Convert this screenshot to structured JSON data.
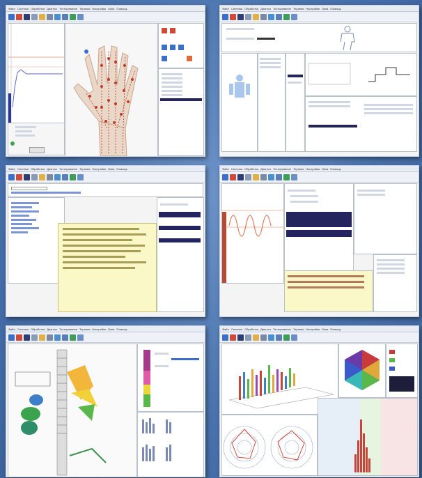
{
  "screenshots": [
    {
      "name": "hand-acupuncture-view",
      "menu": [
        "Файл",
        "Система",
        "Обработка",
        "Диагноз",
        "Тестирование",
        "Терапия",
        "Настройки",
        "Окна",
        "Помощь"
      ]
    },
    {
      "name": "patient-body-diagram-view",
      "menu": [
        "Файл",
        "Система",
        "Обработка",
        "Диагноз",
        "Тестирование",
        "Терапия",
        "Настройки",
        "Окна",
        "Помощь"
      ]
    },
    {
      "name": "diagnosis-list-view",
      "menu": [
        "Файл",
        "Система",
        "Обработка",
        "Диагноз",
        "Тестирование",
        "Терапия",
        "Настройки",
        "Окна",
        "Помощь"
      ]
    },
    {
      "name": "waveform-analysis-view",
      "menu": [
        "Файл",
        "Система",
        "Обработка",
        "Диагноз",
        "Тестирование",
        "Терапия",
        "Настройки",
        "Окна",
        "Помощь"
      ]
    },
    {
      "name": "spine-organs-view",
      "menu": [
        "Файл",
        "Система",
        "Обработка",
        "Диагноз",
        "Тестирование",
        "Терапия",
        "Настройки",
        "Окна",
        "Помощь"
      ]
    },
    {
      "name": "spectrum-charts-view",
      "menu": [
        "Файл",
        "Система",
        "Обработка",
        "Диагноз",
        "Тестирование",
        "Терапия",
        "Настройки",
        "Окна",
        "Помощь"
      ]
    }
  ],
  "colors": {
    "background": "#4a73ad",
    "window": "#f4f4f4",
    "selection": "#24245e",
    "meridian_points": "#c0392b",
    "note_yellow": "#fbf8c8"
  },
  "icons": [
    "new-file-icon",
    "pen-icon",
    "save-icon",
    "print-icon",
    "open-icon",
    "settings-icon",
    "user-icon",
    "search-icon",
    "chart-icon",
    "help-icon"
  ]
}
